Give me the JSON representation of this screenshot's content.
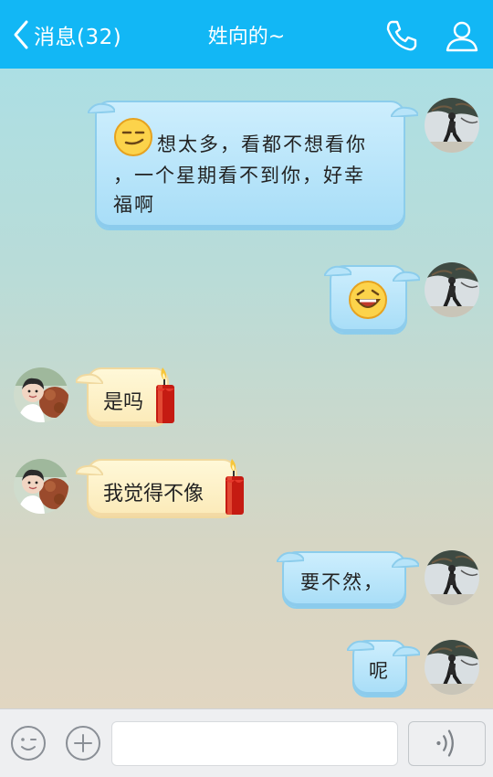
{
  "header": {
    "back_label": "消息(32)",
    "title": "姓向的~",
    "icons": [
      "phone-icon",
      "profile-icon"
    ]
  },
  "messages": [
    {
      "side": "right",
      "emoji": "smirk",
      "text": [
        "想太多，看都不想看你",
        "，一个星期看不到你，好幸",
        "福啊"
      ]
    },
    {
      "side": "right",
      "emoji": "laughing",
      "text": []
    },
    {
      "side": "left",
      "text": "是吗",
      "sticker": "candle"
    },
    {
      "side": "left",
      "text": "我觉得不像",
      "sticker": "candle"
    },
    {
      "side": "right",
      "text": "要不然，"
    },
    {
      "side": "right",
      "text": "呢"
    }
  ],
  "input": {
    "value": "",
    "placeholder": ""
  },
  "colors": {
    "header": "#12b7f5",
    "bubble_right": "#a7ddf7",
    "bubble_left": "#fbeab8"
  }
}
